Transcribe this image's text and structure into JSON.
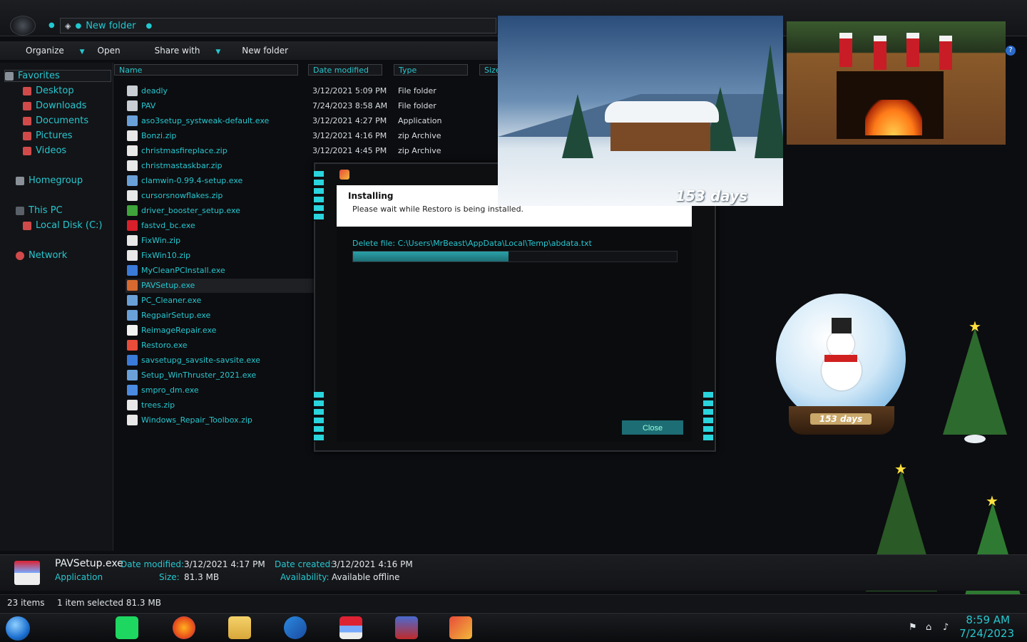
{
  "explorer": {
    "address": {
      "crumb": "New folder"
    },
    "toolbar": {
      "organize": "Organize",
      "open": "Open",
      "share_with": "Share with",
      "new_folder": "New folder"
    },
    "sidebar": {
      "favorites": "Favorites",
      "desktop": "Desktop",
      "downloads": "Downloads",
      "documents": "Documents",
      "pictures": "Pictures",
      "videos": "Videos",
      "homegroup": "Homegroup",
      "this_pc": "This PC",
      "local_disk": "Local Disk (C:)",
      "network": "Network"
    },
    "columns": {
      "name": "Name",
      "date_modified": "Date modified",
      "type": "Type",
      "size": "Size"
    },
    "files": [
      {
        "name": "deadly",
        "date": "3/12/2021 5:09 PM",
        "type": "File folder",
        "icon": "folder-icon",
        "color": "#c9ced4"
      },
      {
        "name": "PAV",
        "date": "7/24/2023 8:58 AM",
        "type": "File folder",
        "icon": "folder-icon",
        "color": "#c9ced4"
      },
      {
        "name": "aso3setup_systweak-default.exe",
        "date": "3/12/2021 4:27 PM",
        "type": "Application",
        "icon": "installer-icon",
        "color": "#6aa0d8"
      },
      {
        "name": "Bonzi.zip",
        "date": "3/12/2021 4:16 PM",
        "type": "zip Archive",
        "icon": "zip-icon",
        "color": "#e8e8e8"
      },
      {
        "name": "christmasfireplace.zip",
        "date": "3/12/2021 4:45 PM",
        "type": "zip Archive",
        "icon": "zip-icon",
        "color": "#e8e8e8"
      },
      {
        "name": "christmastaskbar.zip",
        "date": "",
        "type": "",
        "icon": "zip-icon",
        "color": "#e8e8e8"
      },
      {
        "name": "clamwin-0.99.4-setup.exe",
        "date": "",
        "type": "",
        "icon": "installer-icon",
        "color": "#6aa0d8"
      },
      {
        "name": "cursorsnowflakes.zip",
        "date": "",
        "type": "",
        "icon": "zip-icon",
        "color": "#e8e8e8"
      },
      {
        "name": "driver_booster_setup.exe",
        "date": "",
        "type": "",
        "icon": "driver-booster-icon",
        "color": "#3fa43a"
      },
      {
        "name": "fastvd_bc.exe",
        "date": "",
        "type": "",
        "icon": "v-icon",
        "color": "#d8202a"
      },
      {
        "name": "FixWin.zip",
        "date": "",
        "type": "",
        "icon": "zip-icon",
        "color": "#e8e8e8"
      },
      {
        "name": "FixWin10.zip",
        "date": "",
        "type": "",
        "icon": "zip-icon",
        "color": "#e8e8e8"
      },
      {
        "name": "MyCleanPCInstall.exe",
        "date": "",
        "type": "",
        "icon": "mycleanpc-icon",
        "color": "#3a7ad8"
      },
      {
        "name": "PAVSetup.exe",
        "date": "",
        "type": "",
        "icon": "package-icon",
        "color": "#d86a30"
      },
      {
        "name": "PC_Cleaner.exe",
        "date": "",
        "type": "",
        "icon": "installer-icon",
        "color": "#6aa0d8"
      },
      {
        "name": "RegpairSetup.exe",
        "date": "",
        "type": "",
        "icon": "installer-icon",
        "color": "#6aa0d8"
      },
      {
        "name": "ReimageRepair.exe",
        "date": "",
        "type": "",
        "icon": "reimage-icon",
        "color": "#f2f2f2"
      },
      {
        "name": "Restoro.exe",
        "date": "",
        "type": "",
        "icon": "restoro-icon",
        "color": "#e84c3a"
      },
      {
        "name": "savsetupg_savsite-savsite.exe",
        "date": "",
        "type": "",
        "icon": "shield-icon",
        "color": "#3a7ad8"
      },
      {
        "name": "Setup_WinThruster_2021.exe",
        "date": "",
        "type": "",
        "icon": "installer-icon",
        "color": "#6aa0d8"
      },
      {
        "name": "smpro_dm.exe",
        "date": "",
        "type": "",
        "icon": "download-icon",
        "color": "#4a8ae0"
      },
      {
        "name": "trees.zip",
        "date": "",
        "type": "",
        "icon": "zip-icon",
        "color": "#e8e8e8"
      },
      {
        "name": "Windows_Repair_Toolbox.zip",
        "date": "",
        "type": "",
        "icon": "zip-icon",
        "color": "#e8e8e8"
      }
    ],
    "details": {
      "name": "PAVSetup.exe",
      "type": "Application",
      "date_modified_label": "Date modified:",
      "date_modified": "3/12/2021 4:17 PM",
      "size_label": "Size:",
      "size": "81.3 MB",
      "date_created_label": "Date created:",
      "date_created": "3/12/2021 4:16 PM",
      "availability_label": "Availability:",
      "availability": "Available offline"
    },
    "status": {
      "items": "23 items",
      "selected": "1 item selected  81.3 MB"
    }
  },
  "installer": {
    "title": "Installing",
    "subtitle": "Please wait while Restoro is being installed.",
    "status": "Delete file: C:\\Users\\MrBeast\\AppData\\Local\\Temp\\abdata.txt",
    "progress": 0.48,
    "close_label": "Close"
  },
  "widgets": {
    "countdown_snow": "153 days",
    "countdown_globe": "153 days"
  },
  "taskbar": {
    "time": "8:59 AM",
    "date": "7/24/2023"
  },
  "colors": {
    "accent": "#27c7cf",
    "background": "#0c0d10"
  }
}
